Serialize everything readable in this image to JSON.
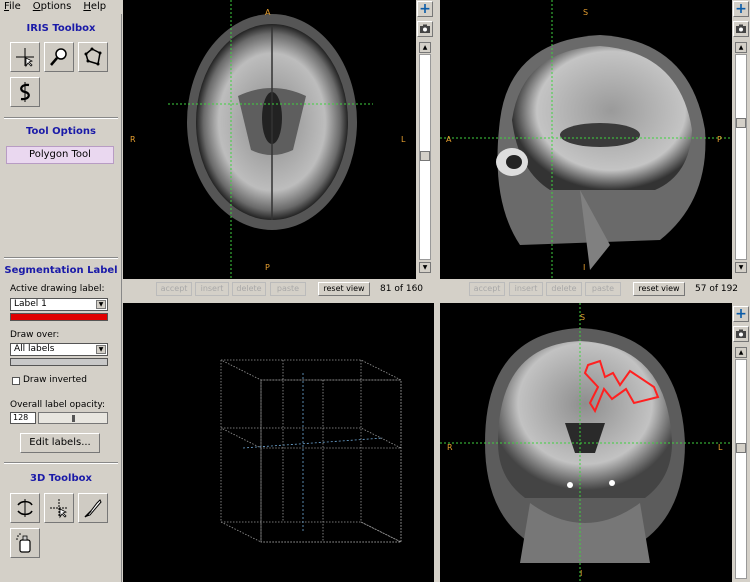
{
  "menu": {
    "file": "File",
    "options": "Options",
    "help": "Help"
  },
  "iris_toolbox": {
    "title": "IRIS Toolbox",
    "tools": [
      "crosshair-tool-icon",
      "zoom-tool-icon",
      "polygon-tool-icon",
      "snake-tool-icon"
    ]
  },
  "tool_options": {
    "title": "Tool Options",
    "active_tool": "Polygon Tool"
  },
  "segmentation": {
    "title": "Segmentation Label",
    "active_label_caption": "Active drawing label:",
    "active_label_value": "Label 1",
    "label_color": "#e00000",
    "draw_over_caption": "Draw over:",
    "draw_over_value": "All labels",
    "draw_over_color": "#c8c8c8",
    "draw_inverted": "Draw inverted",
    "opacity_caption": "Overall label opacity:",
    "opacity_value": "128",
    "opacity_fraction": 0.5,
    "edit_labels": "Edit labels..."
  },
  "toolbox_3d": {
    "title": "3D Toolbox",
    "tools": [
      "rotate-3d-icon",
      "crosshair-3d-icon",
      "scalpel-icon",
      "spraypaint-icon"
    ]
  },
  "views": {
    "axial": {
      "top": "A",
      "bottom": "P",
      "left": "R",
      "right": "L",
      "slice": "81 of 160"
    },
    "sagittal": {
      "top": "S",
      "bottom": "I",
      "left": "A",
      "right": "P",
      "slice": "57 of 192"
    },
    "coronal": {
      "top": "S",
      "bottom": "I",
      "left": "R",
      "right": "L"
    }
  },
  "viewbar_buttons": {
    "accept": "accept",
    "insert": "insert",
    "delete": "delete",
    "paste": "paste",
    "reset": "reset view"
  },
  "colors": {
    "crosshair": "#3fd13f",
    "orientation": "#e8a030",
    "title": "#1a1aa8",
    "polygon": "#ff2020",
    "toggle_blue": "#0b5ca8"
  }
}
